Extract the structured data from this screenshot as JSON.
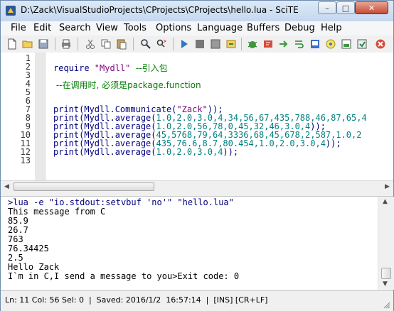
{
  "window": {
    "title": "D:\\Zack\\VisualStudioProjects\\CProjects\\CProjects\\hello.lua - SciTE",
    "min_glyph": "–",
    "max_glyph": "□",
    "close_glyph": "✕"
  },
  "menu": [
    "File",
    "Edit",
    "Search",
    "View",
    "Tools",
    "Options",
    "Language",
    "Buffers",
    "Debug",
    "Help"
  ],
  "toolbar_icons": [
    "new-file-icon",
    "open-folder-icon",
    "save-icon",
    "print-icon",
    "cut-icon",
    "copy-icon",
    "paste-icon",
    "find-icon",
    "replace-icon",
    "run-icon",
    "stop-icon",
    "compile-icon",
    "build-icon",
    "bug-icon",
    "bookmark-icon",
    "next-icon",
    "wrap-icon",
    "cd-icon",
    "window-icon",
    "export-icon",
    "settings-icon",
    "close-icon"
  ],
  "editor": {
    "line_numbers": [
      "1",
      "2",
      "3",
      "4",
      "5",
      "6",
      "7",
      "8",
      "9",
      "10",
      "11",
      "12",
      "13"
    ],
    "lines": [
      [],
      [
        {
          "t": "require ",
          "c": "lua-kw"
        },
        {
          "t": "\"Mydll\"",
          "c": "lua-str"
        },
        {
          "t": "  --引入包",
          "c": "lua-com"
        }
      ],
      [],
      [
        {
          "t": " --在调用时, 必须是package.function",
          "c": "lua-com"
        }
      ],
      [],
      [],
      [
        {
          "t": "print(Mydll.Communicate(",
          "c": "lua-kw"
        },
        {
          "t": "\"Zack\"",
          "c": "lua-str"
        },
        {
          "t": "));",
          "c": "lua-kw"
        }
      ],
      [
        {
          "t": "print(Mydll.average(",
          "c": "lua-kw"
        },
        {
          "t": "1.0,2.0,3.0,4,34,56,67,435,788,46,87,65,4",
          "c": "lua-num"
        }
      ],
      [
        {
          "t": "print(Mydll.average(",
          "c": "lua-kw"
        },
        {
          "t": "1.0,2.0,56,78,0,45,32,46,3.0,4",
          "c": "lua-num"
        },
        {
          "t": "));",
          "c": "lua-kw"
        }
      ],
      [
        {
          "t": "print(Mydll.average(",
          "c": "lua-kw"
        },
        {
          "t": "45,5768,79,64,3336,68,45,678,2,587,1.0,2",
          "c": "lua-num"
        }
      ],
      [
        {
          "t": "print(Mydll.average(",
          "c": "lua-kw"
        },
        {
          "t": "435,76.6,8.7,80.454,1.0,2.0,3.0,4",
          "c": "lua-num"
        },
        {
          "t": "));",
          "c": "lua-kw"
        }
      ],
      [
        {
          "t": "print(Mydll.average(",
          "c": "lua-kw"
        },
        {
          "t": "1.0,2.0,3.0,4",
          "c": "lua-num"
        },
        {
          "t": "));",
          "c": "lua-kw"
        }
      ],
      []
    ]
  },
  "output": {
    "command": ">lua -e \"io.stdout:setvbuf 'no'\" \"hello.lua\"",
    "lines": [
      "This message from C",
      "85.9",
      "26.7",
      "763",
      "76.34425",
      "2.5",
      "Hello Zack",
      "I`m in C,I send a message to you>Exit code: 0"
    ]
  },
  "status": {
    "text": "Ln: 11 Col: 56 Sel: 0  |  Saved: 2016/1/2  16:57:14  |  [INS] [CR+LF]"
  }
}
